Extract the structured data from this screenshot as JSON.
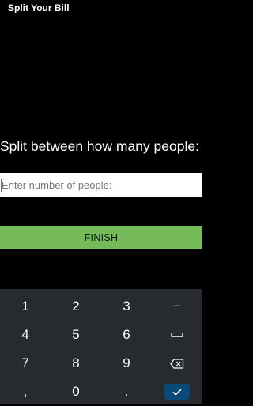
{
  "app": {
    "title": "Split Your Bill"
  },
  "prompt": {
    "text": "Split between how many people:"
  },
  "people_input": {
    "value": "",
    "placeholder": "Enter number of people:"
  },
  "finish_button": {
    "label": "FINISH"
  },
  "keyboard": {
    "keys": {
      "k1": "1",
      "k2": "2",
      "k3": "3",
      "minus": "−",
      "k4": "4",
      "k5": "5",
      "k6": "6",
      "k7": "7",
      "k8": "8",
      "k9": "9",
      "comma": ",",
      "k0": "0",
      "period": "."
    },
    "icons": {
      "space": "space-icon",
      "backspace": "backspace-icon",
      "done": "checkmark-icon"
    }
  },
  "colors": {
    "background": "#000000",
    "finish_button": "#76bb5a",
    "keyboard_bg": "#272a2f",
    "done_key": "#0b4a77",
    "caret": "#2f7de1"
  }
}
